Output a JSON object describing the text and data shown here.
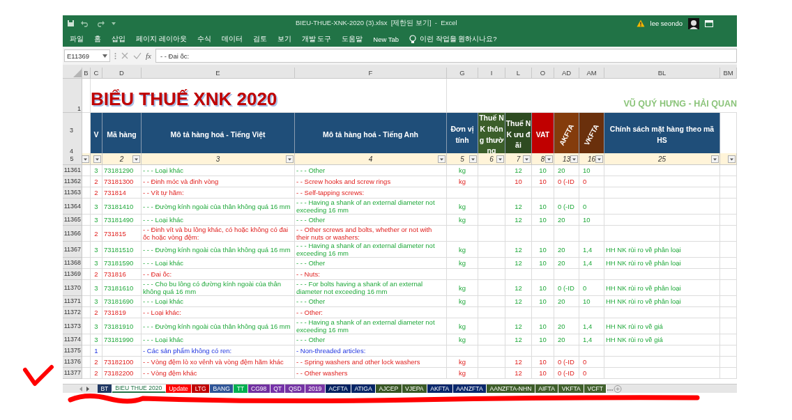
{
  "window": {
    "title": "BIEU-THUE-XNK-2020 (3).xlsx  [제한된 보기]  -  Excel",
    "user": "lee seondo"
  },
  "menu": [
    "파일",
    "홈",
    "삽입",
    "페이지 레이아웃",
    "수식",
    "데이터",
    "검토",
    "보기",
    "개발 도구",
    "도움말",
    "New Tab"
  ],
  "tell_me": "이런 작업을 원하시나요?",
  "formula_bar": {
    "name_box": "E11369",
    "fx_label": "fx",
    "formula": "- - Đai ốc:"
  },
  "column_headers": [
    "B",
    "C",
    "D",
    "E",
    "F",
    "G",
    "I",
    "L",
    "O",
    "AD",
    "AM",
    "BL",
    "BM"
  ],
  "sheet": {
    "title_row": "1",
    "header_rows": [
      "3",
      "4"
    ],
    "filter_row": "5",
    "title": "BIỂU THUẾ XNK 2020",
    "author": "VŨ QUÝ HƯNG - HẢI QUAN",
    "table_header": [
      {
        "label": "V",
        "color": "#1f4e79",
        "kind": "plain"
      },
      {
        "label": "Mã hàng",
        "color": "#1f4e79",
        "kind": "plain"
      },
      {
        "label": "Mô tả hàng hoá - Tiếng Việt",
        "color": "#1f4e79",
        "kind": "plain"
      },
      {
        "label": "Mô tả hàng hoá - Tiếng Anh",
        "color": "#1f4e79",
        "kind": "plain"
      },
      {
        "label": "Đơn vị tính",
        "color": "#1f4e79",
        "kind": "plain"
      },
      {
        "label": "Thuế NK thông thường",
        "color": "#3b5e2a",
        "kind": "small"
      },
      {
        "label": "Thuế NK ưu đãi",
        "color": "#2e4b21",
        "kind": "small"
      },
      {
        "label": "VAT",
        "color": "#c00000",
        "kind": "plain"
      },
      {
        "label": "AKFTA",
        "color": "#843c0c",
        "kind": "rotated"
      },
      {
        "label": "VKFTA",
        "color": "#6a300c",
        "kind": "rotated"
      },
      {
        "label": "Chính sách mặt hàng theo mã HS",
        "color": "#1f4e79",
        "kind": "plain"
      }
    ],
    "filter_labels": {
      "D": "2",
      "E": "3",
      "F": "4",
      "G": "5",
      "I": "6",
      "L": "7",
      "O": "8",
      "AD": "13",
      "AM": "16",
      "BL": "25"
    }
  },
  "rows": [
    {
      "row": "11361",
      "kind": "item",
      "v": "3",
      "code": "73181290",
      "vn": "- - - Loại khác",
      "en": "- - - Other",
      "unit": "kg",
      "pref": "12",
      "vat": "10",
      "akfta": "20",
      "vkfta": "10"
    },
    {
      "row": "11362",
      "kind": "subgroup",
      "v": "2",
      "code": "73181300",
      "vn": "- - Đinh móc và đinh vòng",
      "en": "- - Screw hooks and screw rings",
      "unit": "kg",
      "pref": "10",
      "vat": "10",
      "akfta": "0 (-ID",
      "vkfta": "0"
    },
    {
      "row": "11363",
      "kind": "subgroup",
      "v": "2",
      "code": "731814",
      "vn": "- - Vít tự hãm:",
      "en": "- - Self-tapping screws:"
    },
    {
      "row": "11364",
      "kind": "item",
      "v": "3",
      "code": "73181410",
      "vn": "- - - Đường kính ngoài của thân không quá 16 mm",
      "en": "- - - Having a shank of an external diameter not exceeding 16 mm",
      "unit": "kg",
      "pref": "12",
      "vat": "10",
      "akfta": "0 (-ID",
      "vkfta": "0"
    },
    {
      "row": "11365",
      "kind": "item",
      "v": "3",
      "code": "73181490",
      "vn": "- - - Loại khác",
      "en": "- - - Other",
      "unit": "kg",
      "pref": "12",
      "vat": "10",
      "akfta": "20",
      "vkfta": "10"
    },
    {
      "row": "11366",
      "kind": "subgroup",
      "v": "2",
      "code": "731815",
      "vn": "- - Đinh vít và bu lông khác, có hoặc không có đai ốc hoặc vòng đệm:",
      "en": "- - Other screws and bolts, whether or not with their nuts or washers:"
    },
    {
      "row": "11367",
      "kind": "item",
      "v": "3",
      "code": "73181510",
      "vn": "- - - Đường kính ngoài của thân không quá 16 mm",
      "en": "- - - Having a shank of an external diameter not exceeding 16 mm",
      "unit": "kg",
      "pref": "12",
      "vat": "10",
      "akfta": "20",
      "vkfta": "1,4",
      "policy": "HH NK rủi ro về phân loại"
    },
    {
      "row": "11368",
      "kind": "item",
      "v": "3",
      "code": "73181590",
      "vn": "- - - Loại khác",
      "en": "- - - Other",
      "unit": "kg",
      "pref": "12",
      "vat": "10",
      "akfta": "20",
      "vkfta": "1,4",
      "policy": "HH NK rủi ro về phân loại"
    },
    {
      "row": "11369",
      "kind": "subgroup",
      "v": "2",
      "code": "731816",
      "vn": "- - Đai ốc:",
      "en": "- - Nuts:"
    },
    {
      "row": "11370",
      "kind": "item",
      "v": "3",
      "code": "73181610",
      "vn": "- - - Cho bu lông có đường kính ngoài của thân không quá 16 mm",
      "en": "- - - For bolts having a shank of an external diameter not exceeding 16 mm",
      "unit": "kg",
      "pref": "12",
      "vat": "10",
      "akfta": "0 (-ID",
      "vkfta": "0",
      "policy": "HH NK rủi ro về phân loại"
    },
    {
      "row": "11371",
      "kind": "item",
      "v": "3",
      "code": "73181690",
      "vn": "- - - Loại khác",
      "en": "- - - Other",
      "unit": "kg",
      "pref": "12",
      "vat": "10",
      "akfta": "20",
      "vkfta": "10",
      "policy": "HH NK rủi ro về phân loại"
    },
    {
      "row": "11372",
      "kind": "subgroup",
      "v": "2",
      "code": "731819",
      "vn": "- - Loại khác:",
      "en": "- - Other:"
    },
    {
      "row": "11373",
      "kind": "item",
      "v": "3",
      "code": "73181910",
      "vn": "- - - Đường kính ngoài của thân không quá 16 mm",
      "en": "- - - Having a shank of an external diameter not exceeding 16 mm",
      "unit": "kg",
      "pref": "12",
      "vat": "10",
      "akfta": "20",
      "vkfta": "1,4",
      "policy": "HH NK rủi ro về giá"
    },
    {
      "row": "11374",
      "kind": "item",
      "v": "3",
      "code": "73181990",
      "vn": "- - - Loại khác",
      "en": "- - - Other",
      "unit": "kg",
      "pref": "12",
      "vat": "10",
      "akfta": "20",
      "vkfta": "1,4",
      "policy": "HH NK rủi ro về giá"
    },
    {
      "row": "11375",
      "kind": "group",
      "v": "1",
      "vn": "- Các sản phẩm không có ren:",
      "en": "- Non-threaded articles:"
    },
    {
      "row": "11376",
      "kind": "subgroup",
      "v": "2",
      "code": "73182100",
      "vn": "- - Vòng đệm lò xo vênh và vòng đệm hãm khác",
      "en": "- - Spring washers and other lock washers",
      "unit": "kg",
      "pref": "12",
      "vat": "10",
      "akfta": "0 (-ID",
      "vkfta": "0"
    },
    {
      "row": "11377",
      "kind": "subgroup",
      "v": "2",
      "code": "73182200",
      "vn": "- - Vòng đệm khác",
      "en": "- - Other washers",
      "unit": "kg",
      "pref": "12",
      "vat": "10",
      "akfta": "0 (-ID",
      "vkfta": "0"
    }
  ],
  "sheet_tabs": [
    {
      "label": "BT",
      "color": "#203864",
      "selected": false
    },
    {
      "label": "BIEU THUE 2020",
      "color": "#217346",
      "selected": true
    },
    {
      "label": "Update",
      "color": "#ff0000",
      "selected": false
    },
    {
      "label": "LTG",
      "color": "#c00000",
      "selected": false
    },
    {
      "label": "BANG",
      "color": "#2f5597",
      "selected": false
    },
    {
      "label": "TT",
      "color": "#00b050",
      "selected": false
    },
    {
      "label": "CG98",
      "color": "#7030a0",
      "selected": false
    },
    {
      "label": "QT",
      "color": "#7532a8",
      "selected": false
    },
    {
      "label": "QSD",
      "color": "#7434a4",
      "selected": false
    },
    {
      "label": "2019",
      "color": "#7a36a6",
      "selected": false
    },
    {
      "label": "ACFTA",
      "color": "#002060",
      "selected": false
    },
    {
      "label": "ATIGA",
      "color": "#042466",
      "selected": false
    },
    {
      "label": "AJCEP",
      "color": "#375623",
      "selected": false
    },
    {
      "label": "VJEPA",
      "color": "#3a5a26",
      "selected": false
    },
    {
      "label": "AKFTA",
      "color": "#06256a",
      "selected": false
    },
    {
      "label": "AANZFTA",
      "color": "#08276c",
      "selected": false
    },
    {
      "label": "AANZFTA-NHN",
      "color": "#3c5c28",
      "selected": false
    },
    {
      "label": "AIFTA",
      "color": "#3e5e2a",
      "selected": false
    },
    {
      "label": "VKFTA",
      "color": "#40602c",
      "selected": false
    },
    {
      "label": "VCFT",
      "color": "#42622e",
      "selected": false
    }
  ]
}
